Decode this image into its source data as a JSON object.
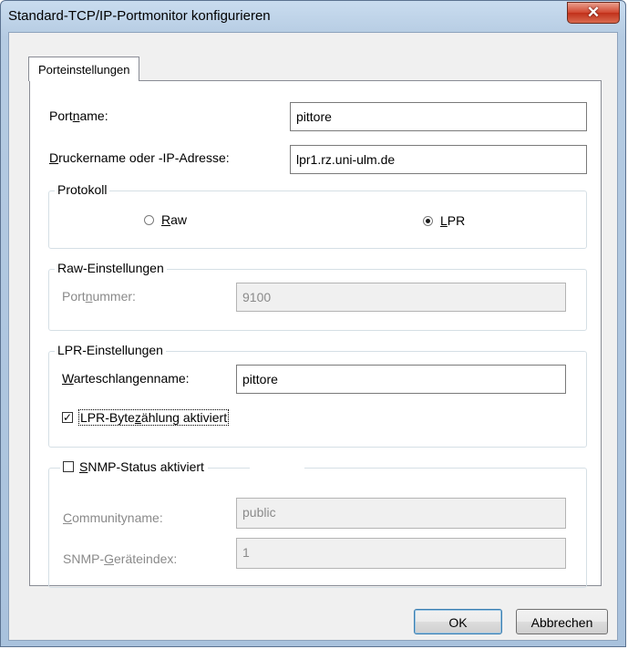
{
  "window": {
    "title": "Standard-TCP/IP-Portmonitor konfigurieren",
    "close_glyph": "✕"
  },
  "tab": {
    "label": "Porteinstellungen"
  },
  "port": {
    "name_label_pre": "Port",
    "name_label_u": "n",
    "name_label_post": "ame:",
    "name_value": "pittore",
    "host_label_u": "D",
    "host_label_post": "ruckername oder -IP-Adresse:",
    "host_value": "lpr1.rz.uni-ulm.de"
  },
  "protocol": {
    "title": "Protokoll",
    "raw_label_u": "R",
    "raw_label_post": "aw",
    "raw_selected": false,
    "lpr_label_u": "L",
    "lpr_label_post": "PR",
    "lpr_selected": true
  },
  "raw_settings": {
    "title": "Raw-Einstellungen",
    "port_label_pre": "Port",
    "port_label_u": "n",
    "port_label_post": "ummer:",
    "port_value": "9100"
  },
  "lpr_settings": {
    "title": "LPR-Einstellungen",
    "queue_label_u": "W",
    "queue_label_post": "arteschlangenname:",
    "queue_value": "pittore",
    "bytecount_pre": "LPR-Byte",
    "bytecount_u": "z",
    "bytecount_post": "ählung aktiviert",
    "bytecount_checked": true
  },
  "snmp": {
    "status_u": "S",
    "status_post": "NMP-Status aktiviert",
    "status_checked": false,
    "community_label_u": "C",
    "community_label_post": "ommunityname:",
    "community_value": "public",
    "device_label_pre": "SNMP-",
    "device_label_u": "G",
    "device_label_post": "eräteindex:",
    "device_value": "1"
  },
  "buttons": {
    "ok": "OK",
    "cancel": "Abbrechen"
  },
  "colors": {
    "accent": "#3c7fb1",
    "close": "#c1301a",
    "disabled_text": "#8a8a8a"
  }
}
